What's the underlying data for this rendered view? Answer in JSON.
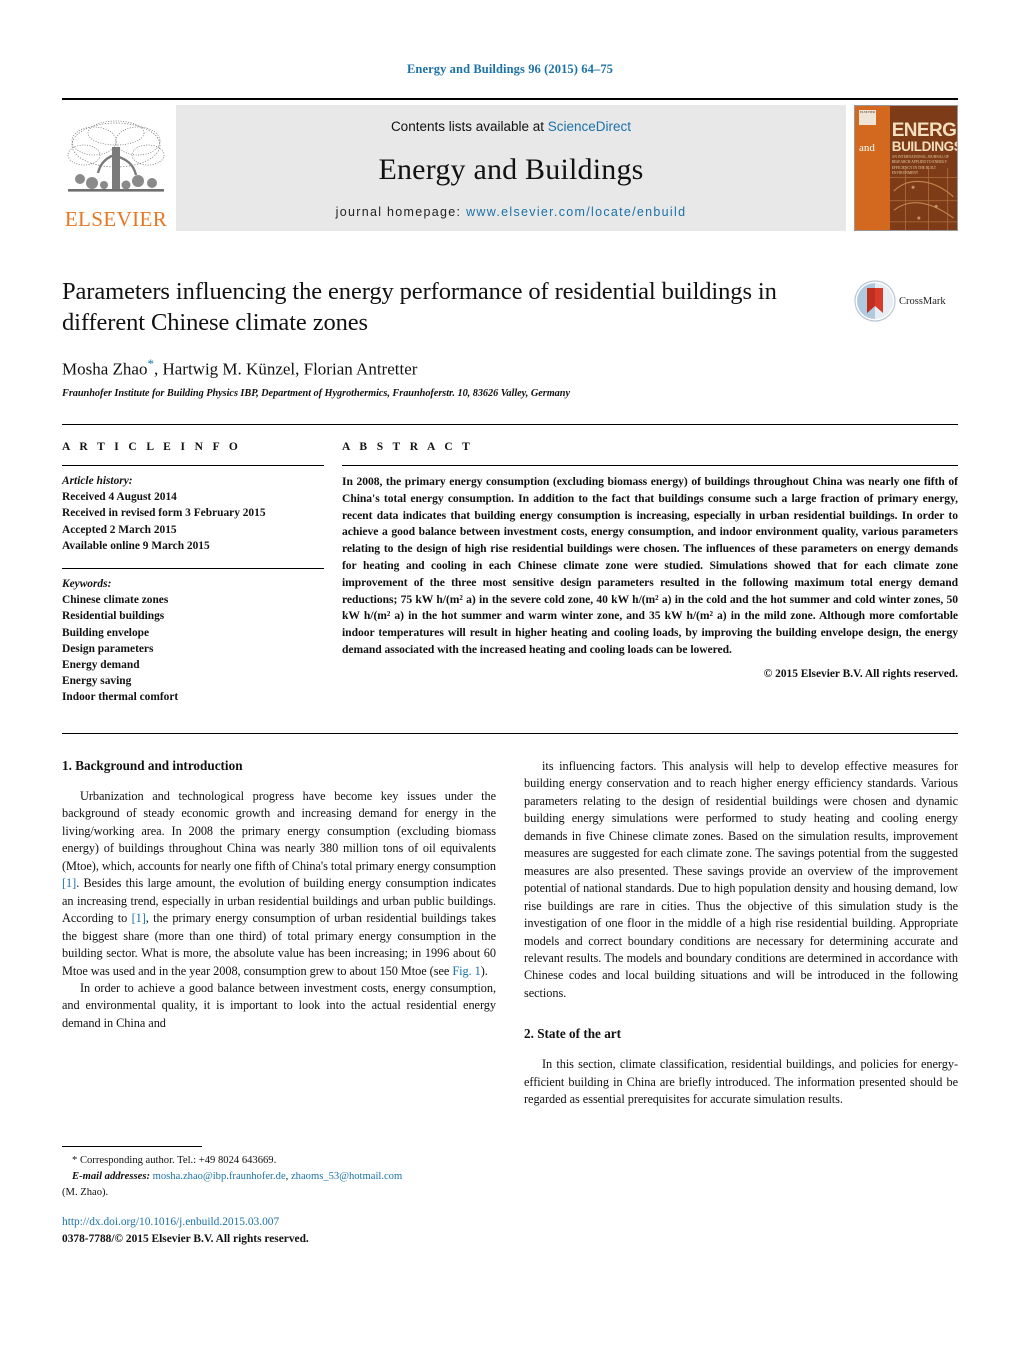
{
  "running_head": "Energy and Buildings 96 (2015) 64–75",
  "masthead": {
    "contents_prefix": "Contents lists available at ",
    "sciencedirect": "ScienceDirect",
    "journal_title": "Energy and Buildings",
    "homepage_prefix": "journal homepage: ",
    "homepage_url": "www.elsevier.com/locate/enbuild",
    "publisher": "ELSEVIER",
    "cover": {
      "mark": "ELSEVIER",
      "and": "and",
      "energy": "ENERGY",
      "buildings": "BUILDINGS",
      "subtitle": "AN INTERNATIONAL JOURNAL OF RESEARCH APPLIED TO ENERGY EFFICIENCY IN THE BUILT ENVIRONMENT"
    },
    "accent_blue": "#1b72a8",
    "elsevier_orange": "#E87722"
  },
  "article": {
    "title": "Parameters influencing the energy performance of residential buildings in different Chinese climate zones",
    "authors": "Mosha Zhao",
    "authors_rest": ", Hartwig M. Künzel, Florian Antretter",
    "corresponding_marker": "*",
    "affiliation": "Fraunhofer Institute for Building Physics IBP, Department of Hygrothermics, Fraunhoferstr. 10, 83626 Valley, Germany",
    "crossmark_label": "CrossMark"
  },
  "article_info": {
    "heading": "A R T I C L E   I N F O",
    "history_label": "Article history:",
    "history": [
      "Received 4 August 2014",
      "Received in revised form 3 February 2015",
      "Accepted 2 March 2015",
      "Available online 9 March 2015"
    ],
    "keywords_label": "Keywords:",
    "keywords": [
      "Chinese climate zones",
      "Residential buildings",
      "Building envelope",
      "Design parameters",
      "Energy demand",
      "Energy saving",
      "Indoor thermal comfort"
    ]
  },
  "abstract": {
    "heading": "A B S T R A C T",
    "text": "In 2008, the primary energy consumption (excluding biomass energy) of buildings throughout China was nearly one fifth of China's total energy consumption. In addition to the fact that buildings consume such a large fraction of primary energy, recent data indicates that building energy consumption is increasing, especially in urban residential buildings. In order to achieve a good balance between investment costs, energy consumption, and indoor environment quality, various parameters relating to the design of high rise residential buildings were chosen. The influences of these parameters on energy demands for heating and cooling in each Chinese climate zone were studied. Simulations showed that for each climate zone improvement of the three most sensitive design parameters resulted in the following maximum total energy demand reductions; 75 kW h/(m² a) in the severe cold zone, 40 kW h/(m² a) in the cold and the hot summer and cold winter zones, 50 kW h/(m² a) in the hot summer and warm winter zone, and 35 kW h/(m² a) in the mild zone. Although more comfortable indoor temperatures will result in higher heating and cooling loads, by improving the building envelope design, the energy demand associated with the increased heating and cooling loads can be lowered.",
    "copyright": "© 2015 Elsevier B.V. All rights reserved."
  },
  "body": {
    "section1_heading": "1.  Background and introduction",
    "left_para1_a": "Urbanization and technological progress have become key issues under the background of steady economic growth and increasing demand for energy in the living/working area. In 2008 the primary energy consumption (excluding biomass energy) of buildings throughout China was nearly 380 million tons of oil equivalents (Mtoe), which, accounts for nearly one fifth of China's total primary energy consumption ",
    "ref1": "[1]",
    "left_para1_b": ". Besides this large amount, the evolution of building energy consumption indicates an increasing trend, especially in urban residential buildings and urban public buildings. According to ",
    "ref2": "[1]",
    "left_para1_c": ", the primary energy consumption of urban residential buildings takes the biggest share (more than one third) of total primary energy consumption in the building sector. What is more, the absolute value has been increasing; in 1996 about 60 Mtoe was used and in the year 2008, consumption grew to about 150 Mtoe (see ",
    "fig1_ref": "Fig. 1",
    "left_para1_d": ").",
    "left_para2": "In order to achieve a good balance between investment costs, energy consumption, and environmental quality, it is important to look into the actual residential energy demand in China and",
    "right_para1": "its influencing factors. This analysis will help to develop effective measures for building energy conservation and to reach higher energy efficiency standards. Various parameters relating to the design of residential buildings were chosen and dynamic building energy simulations were performed to study heating and cooling energy demands in five Chinese climate zones. Based on the simulation results, improvement measures are suggested for each climate zone. The savings potential from the suggested measures are also presented. These savings provide an overview of the improvement potential of national standards. Due to high population density and housing demand, low rise buildings are rare in cities. Thus the objective of this simulation study is the investigation of one floor in the middle of a high rise residential building. Appropriate models and correct boundary conditions are necessary for determining accurate and relevant results. The models and boundary conditions are determined in accordance with Chinese codes and local building situations and will be introduced in the following sections.",
    "section2_heading": "2.  State of the art",
    "right_para2": "In this section, climate classification, residential buildings, and policies for energy-efficient building in China are briefly introduced. The information presented should be regarded as essential prerequisites for accurate simulation results."
  },
  "footnotes": {
    "corresponding": "* Corresponding author. Tel.: +49 8024 643669.",
    "email_label": "E-mail addresses:",
    "email1": "mosha.zhao@ibp.fraunhofer.de",
    "email_sep": ", ",
    "email2": "zhaoms_53@hotmail.com",
    "email_owner": "(M. Zhao).",
    "doi": "http://dx.doi.org/10.1016/j.enbuild.2015.03.007",
    "issn": "0378-7788/© 2015 Elsevier B.V. All rights reserved."
  }
}
